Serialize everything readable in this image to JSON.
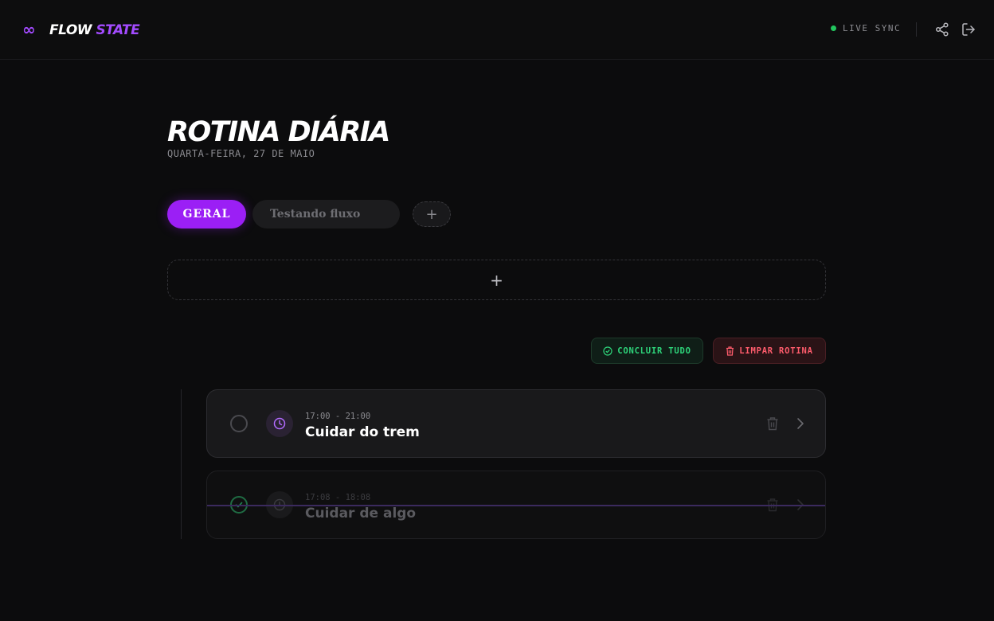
{
  "app": {
    "logo_symbol": "∞",
    "name_part1": "FLOW",
    "name_part2": "STATE",
    "brand_color": "#a34bff"
  },
  "header": {
    "sync_status": "LIVE SYNC",
    "sync_color": "#22c55e",
    "icons": [
      "share-icon",
      "logout-icon"
    ]
  },
  "page": {
    "title": "ROTINA DIÁRIA",
    "date": "QUARTA-FEIRA, 27 DE MAIO"
  },
  "tabs": [
    {
      "label": "GERAL",
      "active": true
    },
    {
      "label": "Testando fluxo",
      "active": false
    }
  ],
  "tab_add_symbol": "+",
  "add_task_symbol": "+",
  "actions": {
    "complete_all": "CONCLUIR TUDO",
    "clear_routine": "LIMPAR ROTINA"
  },
  "tasks": [
    {
      "time": "17:00 - 21:00",
      "title": "Cuidar do trem",
      "done": false
    },
    {
      "time": "17:08 - 18:08",
      "title": "Cuidar de algo",
      "done": true
    }
  ],
  "colors": {
    "accent": "#9b1ff5",
    "success": "#2ed47a",
    "danger": "#ff5c6c",
    "background": "#0c0c0d"
  }
}
